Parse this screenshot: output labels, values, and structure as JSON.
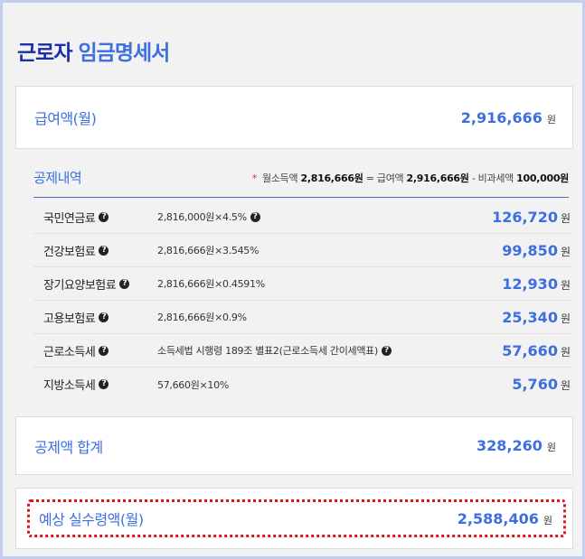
{
  "title": {
    "part1": "근로자",
    "part2": "임금명세서"
  },
  "monthly_pay": {
    "label": "급여액(월)",
    "amount": "2,916,666",
    "unit": "원"
  },
  "deduction": {
    "title": "공제내역",
    "note": {
      "star": "*",
      "t1": "월소득액",
      "v1": "2,816,666원",
      "t2": "= 급여액",
      "v2": "2,916,666원",
      "t3": "- 비과세액",
      "v3": "100,000원"
    },
    "rows": [
      {
        "name": "국민연금료",
        "formula": "2,816,000원×4.5%",
        "formula_help": true,
        "amount": "126,720",
        "unit": "원"
      },
      {
        "name": "건강보험료",
        "formula": "2,816,666원×3.545%",
        "formula_help": false,
        "amount": "99,850",
        "unit": "원"
      },
      {
        "name": "장기요양보험료",
        "formula": "2,816,666원×0.4591%",
        "formula_help": false,
        "amount": "12,930",
        "unit": "원"
      },
      {
        "name": "고용보험료",
        "formula": "2,816,666원×0.9%",
        "formula_help": false,
        "amount": "25,340",
        "unit": "원"
      },
      {
        "name": "근로소득세",
        "formula": "소득세법 시행령 189조 별표2(근로소득세 간이세액표)",
        "formula_help": true,
        "amount": "57,660",
        "unit": "원"
      },
      {
        "name": "지방소득세",
        "formula": "57,660원×10%",
        "formula_help": false,
        "amount": "5,760",
        "unit": "원"
      }
    ]
  },
  "total": {
    "label": "공제액 합계",
    "amount": "328,260",
    "unit": "원"
  },
  "net": {
    "label": "예상 실수령액(월)",
    "amount": "2,588,406",
    "unit": "원"
  },
  "icons": {
    "help": "question-circle-icon",
    "help_glyph": "?"
  },
  "colors": {
    "accent": "#3d6fe0",
    "title_dark": "#1a2fa8",
    "highlight_border": "#e0141e",
    "frame": "#c3cdf0"
  }
}
